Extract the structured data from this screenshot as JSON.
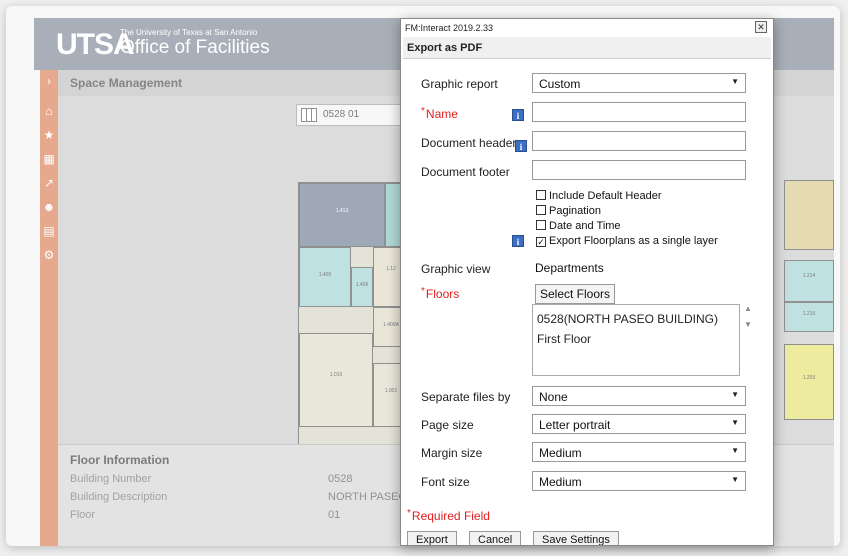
{
  "header": {
    "logo": "UTSA",
    "subtitle": "The University of Texas at San Antonio",
    "title": "Office of Facilities"
  },
  "main": {
    "title": "Space Management",
    "floor_selector": "0528 01",
    "rooms": [
      "1.413",
      "1.405",
      "1.406",
      "1.410",
      "1.409",
      "1.12",
      "1.409A",
      "1.010",
      "1.001",
      "1.214",
      "1.216",
      "1.203",
      "1.228"
    ]
  },
  "floor_info": {
    "title": "Floor Information",
    "rows": [
      {
        "label": "Building Number",
        "value": "0528"
      },
      {
        "label": "Building Description",
        "value": "NORTH PASEO"
      },
      {
        "label": "Floor",
        "value": "01"
      }
    ]
  },
  "dialog": {
    "app_title": "FM:Interact 2019.2.33",
    "close_icon": "close-icon",
    "title": "Export as PDF",
    "graphic_report": {
      "label": "Graphic report",
      "value": "Custom"
    },
    "name": {
      "label": "Name",
      "value": ""
    },
    "document_header": {
      "label": "Document header",
      "value": ""
    },
    "document_footer": {
      "label": "Document footer",
      "value": ""
    },
    "checkboxes": [
      {
        "label": "Include Default Header",
        "checked": false
      },
      {
        "label": "Pagination",
        "checked": false
      },
      {
        "label": "Date and Time",
        "checked": false
      },
      {
        "label": "Export Floorplans as a single layer",
        "checked": true
      }
    ],
    "graphic_view": {
      "label": "Graphic view",
      "value": "Departments"
    },
    "floors": {
      "label": "Floors",
      "button": "Select Floors",
      "items": [
        "0528(NORTH PASEO BUILDING) First Floor"
      ]
    },
    "separate_files_by": {
      "label": "Separate files by",
      "value": "None"
    },
    "page_size": {
      "label": "Page size",
      "value": "Letter portrait"
    },
    "margin_size": {
      "label": "Margin size",
      "value": "Medium"
    },
    "font_size": {
      "label": "Font size",
      "value": "Medium"
    },
    "required_note": "Required Field",
    "buttons": {
      "export": "Export",
      "cancel": "Cancel",
      "save": "Save Settings"
    }
  },
  "colors": {
    "sidebar": "#d97b52",
    "header": "#7c8592",
    "required": "#e02020",
    "info": "#3b6fc5"
  }
}
